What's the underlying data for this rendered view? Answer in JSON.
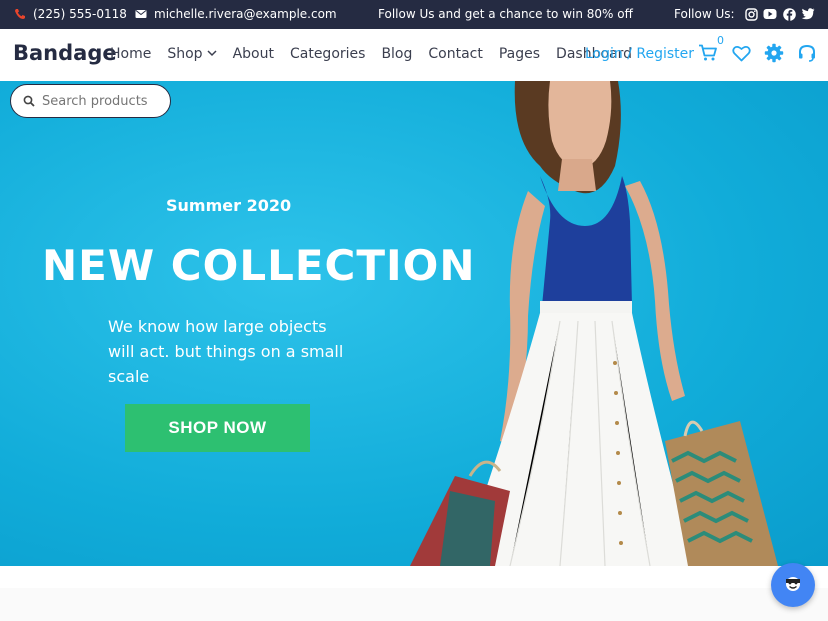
{
  "topbar": {
    "phone": "(225) 555-0118",
    "email": "michelle.rivera@example.com",
    "promo": "Follow Us and get a chance to win 80% off",
    "follow_label": "Follow Us:",
    "social_icons": [
      "instagram-icon",
      "youtube-icon",
      "facebook-icon",
      "twitter-icon"
    ]
  },
  "navbar": {
    "brand": "Bandage",
    "menu": [
      {
        "label": "Home"
      },
      {
        "label": "Shop",
        "has_dropdown": true
      },
      {
        "label": "About"
      },
      {
        "label": "Categories"
      },
      {
        "label": "Blog"
      },
      {
        "label": "Contact"
      },
      {
        "label": "Pages"
      },
      {
        "label": "Dashboard"
      }
    ],
    "login": "Login / Register",
    "cart_count": "0",
    "icons": [
      "cart-icon",
      "heart-icon",
      "gear-icon",
      "headset-icon"
    ]
  },
  "search": {
    "placeholder": "Search products"
  },
  "hero": {
    "season": "Summer 2020",
    "headline": "NEW COLLECTION",
    "description": "We know how large objects will act. but things on a small scale",
    "cta": "SHOP NOW"
  },
  "colors": {
    "topbar_bg": "#252b42",
    "hero_bg": "#1ab0df",
    "accent_blue": "#23a6f0",
    "cta_green": "#2dc071",
    "chat_blue": "#4285f4"
  }
}
